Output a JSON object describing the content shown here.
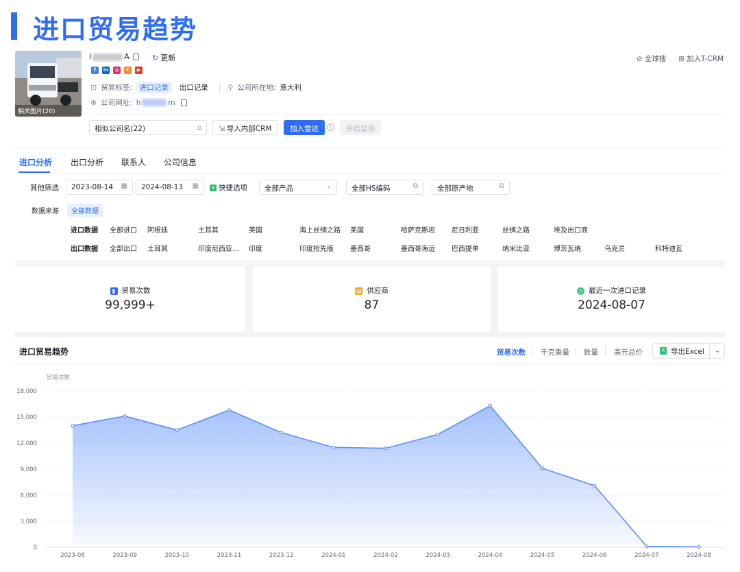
{
  "page_title": "进口贸易趋势",
  "company": {
    "name_prefix": "I",
    "name_suffix": "A",
    "update_label": "更新",
    "photo_caption": "相关图片(20)",
    "trade_tag_label": "贸易标签:",
    "trade_tags": [
      "进口记录",
      "出口记录"
    ],
    "location_label": "公司所在地:",
    "location": "意大利",
    "website_label": "公司网址:",
    "website_prefix": "h",
    "website_suffix": "m"
  },
  "social_icons": [
    {
      "name": "facebook-icon",
      "glyph": "f",
      "color": "#4a7ee0"
    },
    {
      "name": "linkedin-icon",
      "glyph": "in",
      "color": "#0a66c2"
    },
    {
      "name": "instagram-icon",
      "glyph": "◎",
      "color": "#e1306c"
    },
    {
      "name": "phone-icon",
      "glyph": "✆",
      "color": "#f28b25"
    },
    {
      "name": "youtube-icon",
      "glyph": "▶",
      "color": "#e23b2e"
    }
  ],
  "header_actions": {
    "global_search": "全球搜",
    "add_crm": "加入T-CRM"
  },
  "action_bar": {
    "similar": "相似公司名(22)",
    "import_crm": "导入内部CRM",
    "add_radar": "加入雷达",
    "start_monitor": "开启监测"
  },
  "tabs": [
    "进口分析",
    "出口分析",
    "联系人",
    "公司信息"
  ],
  "filters": {
    "label": "其他筛选",
    "date_start": "2023-08-14",
    "date_end": "2024-08-13",
    "quick_label": "快捷选项",
    "product": "全部产品",
    "hs_code": "全部HS编码",
    "origin": "全部原产地"
  },
  "data_source": {
    "label": "数据来源",
    "value": "全部数据",
    "import_label": "进口数据",
    "import_items": [
      "全部进口",
      "阿根廷",
      "土耳其",
      "英国",
      "海上丝绸之路",
      "美国",
      "哈萨克斯坦",
      "尼日利亚",
      "丝绸之路",
      "埃及出口商"
    ],
    "export_label": "出口数据",
    "export_items": [
      "全部出口",
      "土耳其",
      "印度尼西亚…",
      "印度",
      "印度抢先版",
      "墨西哥",
      "墨西哥海运",
      "巴西提单",
      "纳米比亚",
      "博茨瓦纳",
      "乌克兰",
      "科特迪瓦"
    ]
  },
  "stats": [
    {
      "label": "贸易次数",
      "value": "99,999+",
      "icon": "bar-chart-icon",
      "color": "#2f6df6"
    },
    {
      "label": "供应商",
      "value": "87",
      "icon": "supplier-icon",
      "color": "#f5a623"
    },
    {
      "label": "最近一次进口记录",
      "value": "2024-08-07",
      "icon": "clock-icon",
      "color": "#2ec07a"
    }
  ],
  "trend": {
    "title": "进口贸易趋势",
    "metrics": [
      "贸易次数",
      "千克重量",
      "数量",
      "美元总价"
    ],
    "export_label": "导出Excel"
  },
  "chart_data": {
    "type": "area",
    "title": "",
    "ylabel": "贸易次数",
    "xlabel": "",
    "x": [
      "2023-08",
      "2023-09",
      "2023-10",
      "2023-11",
      "2023-12",
      "2024-01",
      "2024-02",
      "2024-03",
      "2024-04",
      "2024-05",
      "2024-06",
      "2024-07",
      "2024-08"
    ],
    "values": [
      14000,
      15100,
      13500,
      15800,
      13200,
      11500,
      11400,
      13000,
      16300,
      9100,
      7100,
      100,
      50
    ],
    "ylim": [
      0,
      18000
    ],
    "yticks": [
      "0",
      "3,000",
      "6,000",
      "9,000",
      "12,000",
      "15,000",
      "18,000"
    ],
    "ytick_values": [
      0,
      3000,
      6000,
      9000,
      12000,
      15000,
      18000
    ],
    "grid": true,
    "color": "#5b8ff9"
  }
}
